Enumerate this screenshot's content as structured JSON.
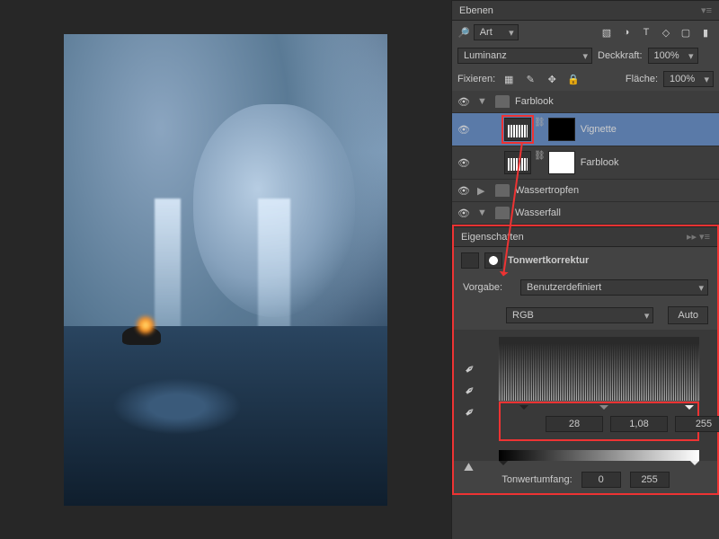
{
  "layers_panel": {
    "title": "Ebenen",
    "filter_label": "Art",
    "blend_row": {
      "mode": "Luminanz",
      "opacity_label": "Deckkraft:",
      "opacity_value": "100%"
    },
    "lock_row": {
      "label": "Fixieren:",
      "fill_label": "Fläche:",
      "fill_value": "100%"
    },
    "layers": [
      {
        "name": "Farblook",
        "type": "group"
      },
      {
        "name": "Vignette",
        "type": "levels",
        "selected": true
      },
      {
        "name": "Farblook",
        "type": "levels"
      },
      {
        "name": "Wassertropfen",
        "type": "group"
      },
      {
        "name": "Wasserfall",
        "type": "group"
      }
    ]
  },
  "properties_panel": {
    "title": "Eigenschaften",
    "adjustment_name": "Tonwertkorrektur",
    "preset_label": "Vorgabe:",
    "preset_value": "Benutzerdefiniert",
    "channel": "RGB",
    "auto_label": "Auto",
    "input_levels": {
      "black": "28",
      "mid": "1,08",
      "white": "255"
    },
    "output_label": "Tonwertumfang:",
    "output_levels": {
      "black": "0",
      "white": "255"
    }
  },
  "icons": {
    "image": "▧",
    "adjust": "◑",
    "text": "T",
    "shape": "◇",
    "smart": "▢",
    "pixel": "▦",
    "brush": "✎",
    "lock": "🔒",
    "link": "⛓",
    "eye": "👁",
    "dropper": "💧",
    "menu": "≡"
  }
}
